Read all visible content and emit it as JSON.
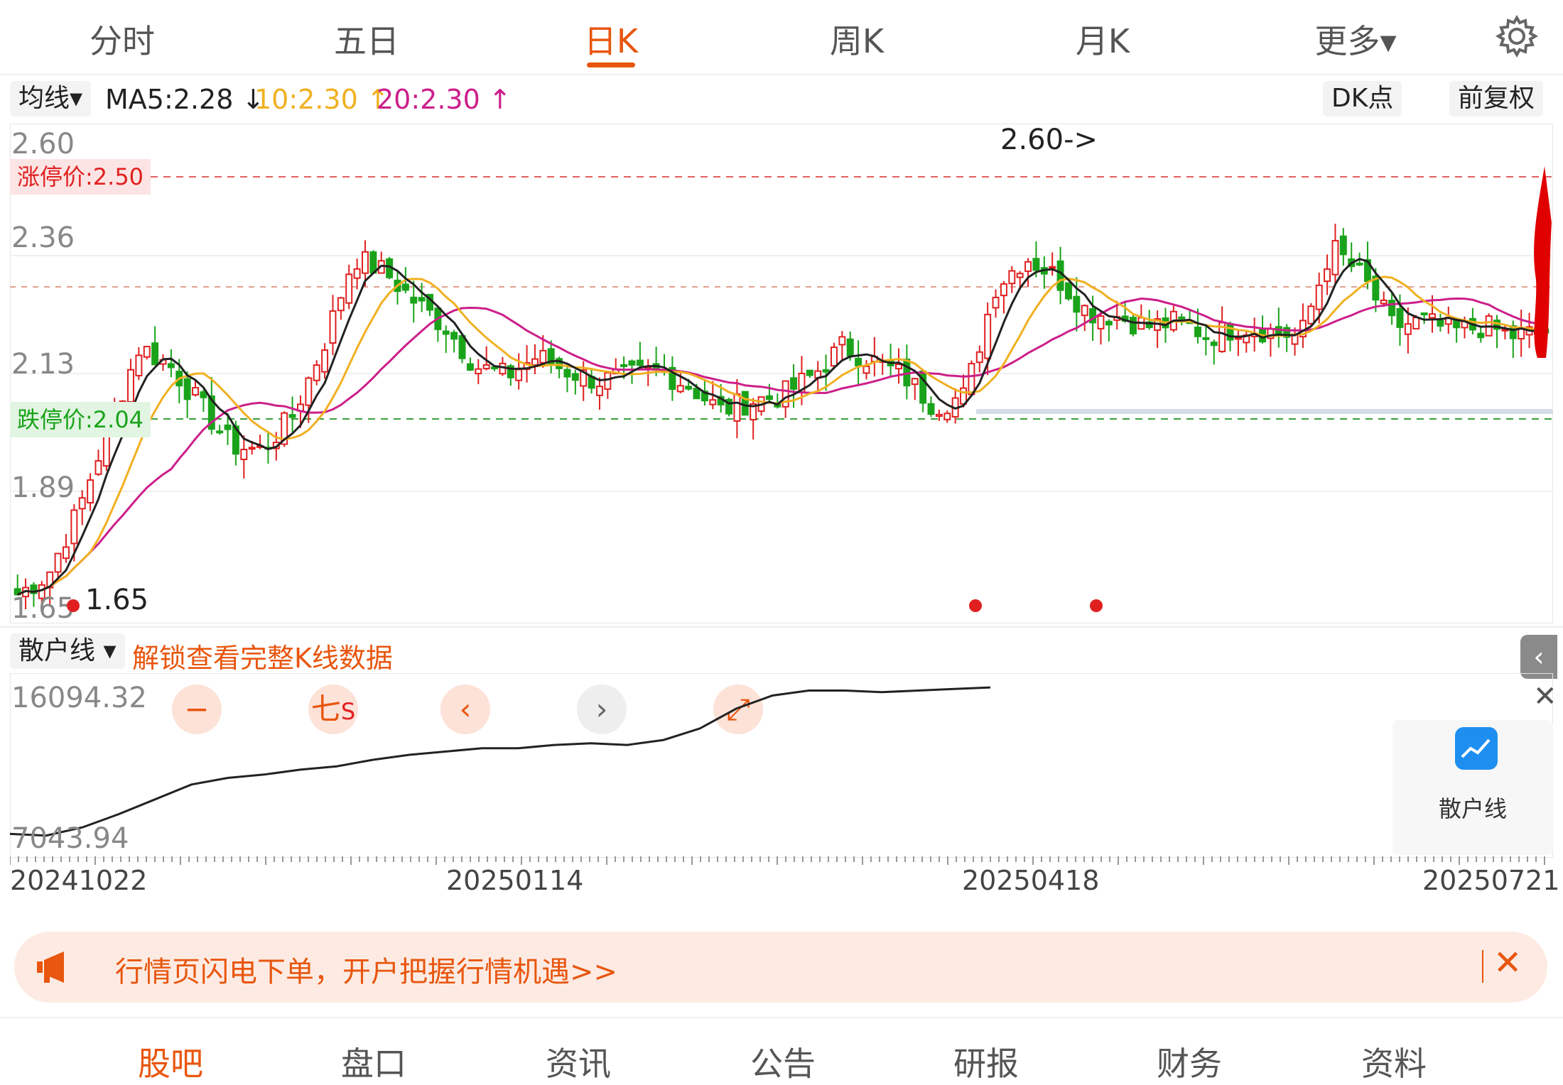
{
  "tabs": [
    {
      "label": "分时"
    },
    {
      "label": "五日"
    },
    {
      "label": "日K"
    },
    {
      "label": "周K"
    },
    {
      "label": "月K"
    },
    {
      "label": "更多▾"
    }
  ],
  "active_tab": "日K",
  "ma_bar": {
    "selector": "均线▾",
    "ma5": "MA5:2.28 ↓",
    "ma10": "10:2.30 ↑",
    "ma20": "20:2.30 ↑",
    "dk_button": "DK点",
    "adjust_button": "前复权"
  },
  "colors": {
    "accent": "#e8560f",
    "up": "#e02020",
    "down": "#1aa31a",
    "ma5": "#222222",
    "ma10": "#f0b020",
    "ma20": "#cc1f8a"
  },
  "price_axis": [
    "2.60",
    "2.36",
    "2.13",
    "1.89",
    "1.65"
  ],
  "limit_up": "涨停价:2.50",
  "limit_down": "跌停价:2.04",
  "high_marker": "2.60->",
  "low_marker": "1.65",
  "chart_controls": [
    {
      "name": "zoom-out-button",
      "glyph": "−"
    },
    {
      "name": "draw-tool-button",
      "glyph": "七",
      "sub": "S"
    },
    {
      "name": "prev-button",
      "glyph": "‹"
    },
    {
      "name": "next-button",
      "glyph": "›"
    },
    {
      "name": "fullscreen-button",
      "glyph": "⤢"
    }
  ],
  "retail": {
    "selector": "散户线 ▾",
    "unlock_text": "解锁查看完整K线数据",
    "max": "16094.32",
    "min": "7043.94",
    "side_label": "散户线"
  },
  "dates": [
    "20241022",
    "20250114",
    "20250418",
    "20250721"
  ],
  "banner_text": "行情页闪电下单，开户把握行情机遇>>",
  "bottom_nav": [
    {
      "label": "股吧"
    },
    {
      "label": "盘口"
    },
    {
      "label": "资讯"
    },
    {
      "label": "公告"
    },
    {
      "label": "研报"
    },
    {
      "label": "财务"
    },
    {
      "label": "资料"
    }
  ],
  "chart_data": {
    "type": "candlestick",
    "ylim": [
      1.65,
      2.6
    ],
    "close_trend": [
      1.68,
      1.72,
      1.85,
      2.02,
      2.18,
      2.14,
      2.06,
      1.98,
      1.97,
      2.04,
      2.18,
      2.36,
      2.33,
      2.27,
      2.22,
      2.14,
      2.12,
      2.16,
      2.13,
      2.11,
      2.12,
      2.13,
      2.1,
      2.05,
      2.07,
      2.08,
      2.12,
      2.18,
      2.15,
      2.12,
      2.06,
      2.08,
      2.3,
      2.36,
      2.32,
      2.25,
      2.24,
      2.22,
      2.23,
      2.2,
      2.22,
      2.21,
      2.2,
      2.38,
      2.32,
      2.22,
      2.23,
      2.21,
      2.22,
      2.2,
      2.21
    ],
    "retail_trend": [
      7200,
      7100,
      7600,
      8400,
      9300,
      10200,
      10600,
      10800,
      11100,
      11300,
      11700,
      12000,
      12200,
      12400,
      12400,
      12600,
      12700,
      12600,
      12900,
      13600,
      14800,
      15600,
      15900,
      15900,
      15800,
      15900,
      16000,
      16090
    ]
  }
}
